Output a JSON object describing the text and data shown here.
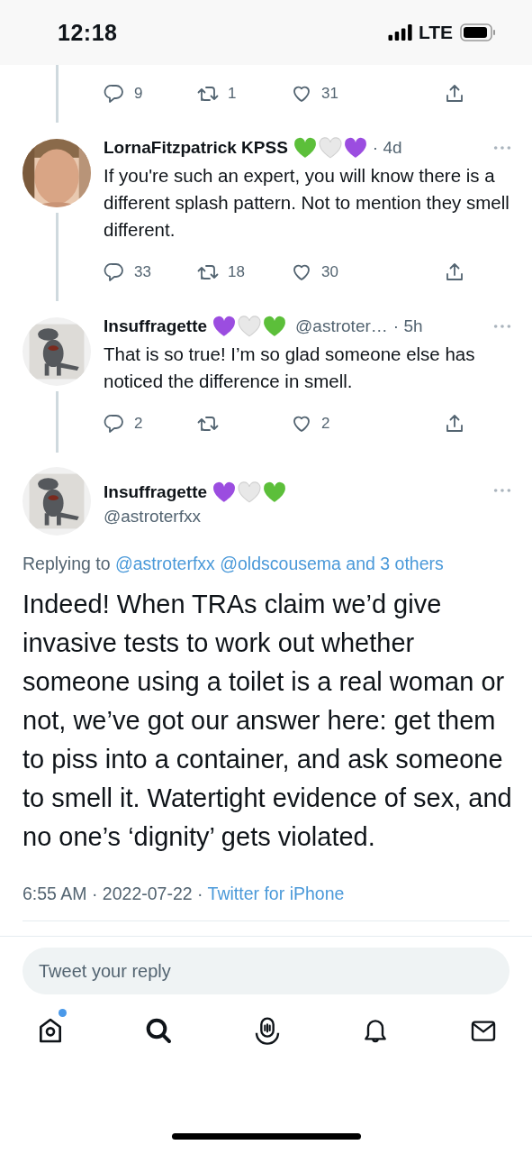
{
  "status_bar": {
    "time": "12:18",
    "network": "LTE"
  },
  "previous_tweet": {
    "stats": {
      "reply": "9",
      "retweet": "1",
      "like": "31"
    }
  },
  "replies": [
    {
      "name": "LornaFitzpatrick KPSS",
      "hearts": [
        {
          "color": "#5cbf3a"
        },
        {
          "color": "#e8e8e8"
        },
        {
          "color": "#9b4de0"
        }
      ],
      "time": "· 4d",
      "text": "If you're such an expert, you will know there is a different splash pattern. Not to mention they smell different.",
      "stats": {
        "reply": "33",
        "retweet": "18",
        "like": "30"
      }
    },
    {
      "name": "Insuffragette",
      "hearts": [
        {
          "color": "#9b4de0"
        },
        {
          "color": "#e8e8e8"
        },
        {
          "color": "#5cbf3a"
        }
      ],
      "handle": "@astroter…",
      "time": "· 5h",
      "text": "That is so true! I’m so glad someone else has noticed the difference in smell.",
      "stats": {
        "reply": "2",
        "like": "2"
      }
    }
  ],
  "main_tweet": {
    "name": "Insuffragette",
    "hearts": [
      {
        "color": "#9b4de0"
      },
      {
        "color": "#e8e8e8"
      },
      {
        "color": "#5cbf3a"
      }
    ],
    "handle": "@astroterfxx",
    "replying_label": "Replying to",
    "replying_links": [
      "@astroterfxx",
      "@oldscousema",
      "and 3 others"
    ],
    "text": "Indeed! When TRAs claim we’d give invasive tests to work out whether someone using a toilet is a real woman or not, we’ve got our answer here: get them to piss into a container, and ask someone to smell it. Watertight evidence of sex, and no one’s ‘dignity’ gets violated.",
    "meta": "6:55 AM · 2022-07-22 ·",
    "source": "Twitter for iPhone"
  },
  "reply_field": {
    "placeholder": "Tweet your reply"
  },
  "nav": [
    {
      "kind": "home",
      "badge": true
    },
    {
      "kind": "search",
      "badge": false
    },
    {
      "kind": "spaces",
      "badge": false
    },
    {
      "kind": "notifications",
      "badge": false
    },
    {
      "kind": "messages",
      "badge": false
    }
  ]
}
